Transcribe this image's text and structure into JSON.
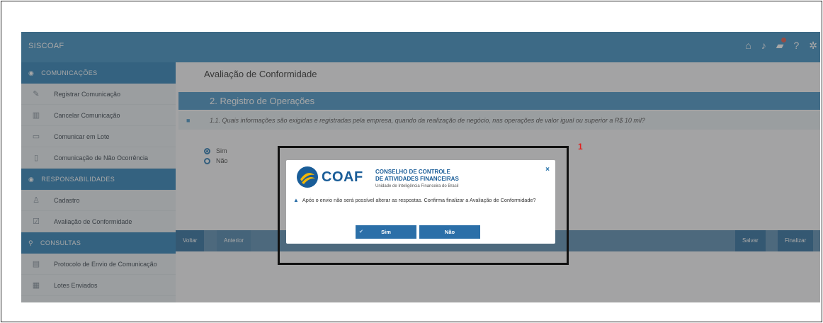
{
  "app": {
    "brand": "SISCOAF"
  },
  "topbar": {
    "icons": [
      "home-icon",
      "bell-icon",
      "truck-icon",
      "help-icon",
      "gear-icon"
    ]
  },
  "sidebar": {
    "groups": [
      {
        "title": "COMUNICAÇÕES",
        "items": [
          "Registrar Comunicação",
          "Cancelar Comunicação",
          "Comunicar em Lote",
          "Comunicação de Não Ocorrência"
        ]
      },
      {
        "title": "RESPONSABILIDADES",
        "items": [
          "Cadastro",
          "Avaliação de Conformidade"
        ]
      },
      {
        "title": "CONSULTAS",
        "items": [
          "Protocolo de Envio de Comunicação",
          "Lotes Enviados"
        ]
      }
    ]
  },
  "main": {
    "title": "Avaliação de Conformidade",
    "section": "2. Registro de Operações",
    "question": "1.1. Quais informações são exigidas e registradas pela empresa, quando da realização de negócio, nas operações de valor igual ou superior a R$ 10 mil?",
    "options": [
      "Sim",
      "Não"
    ],
    "selected_option": "Sim",
    "actions": {
      "back": "Voltar",
      "previous": "Anterior",
      "save": "Salvar",
      "finish": "Finalizar"
    }
  },
  "annotation": {
    "step": "1"
  },
  "dialog": {
    "logo_text": "COAF",
    "org_line1": "CONSELHO DE CONTROLE",
    "org_line2": "DE ATIVIDADES FINANCEIRAS",
    "org_line3": "Unidade de Inteligência Financeira do Brasil",
    "close": "×",
    "message": "Após o envio não será possível alterar as respostas. Confirma finalizar a Avaliação de Conformidade?",
    "yes_label": "Sim",
    "no_label": "Não"
  },
  "colors": {
    "primary": "#3f90c3",
    "sidebar_head": "#2e82b9",
    "dialog_button": "#2b6fa8",
    "annotation": "#e0211f"
  }
}
